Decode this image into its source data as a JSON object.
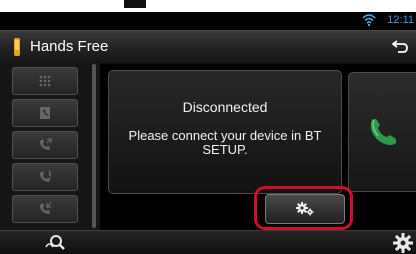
{
  "status_bar": {
    "time": "12:11",
    "icons": [
      "wifi-icon"
    ]
  },
  "title_bar": {
    "title": "Hands Free",
    "icon": "phone-app-icon",
    "back_icon": "back-icon"
  },
  "sidebar": {
    "buttons": [
      {
        "name": "dial-pad-button",
        "icon": "dial-pad-icon"
      },
      {
        "name": "phonebook-button",
        "icon": "phonebook-icon"
      },
      {
        "name": "outgoing-calls-button",
        "icon": "outgoing-call-icon"
      },
      {
        "name": "missed-calls-button",
        "icon": "missed-call-icon"
      },
      {
        "name": "incoming-calls-button",
        "icon": "incoming-call-icon"
      }
    ]
  },
  "message": {
    "status": "Disconnected",
    "instruction": "Please connect your device in BT SETUP."
  },
  "actions": {
    "call_icon": "phone-handset-icon",
    "setup_icon": "settings-gears-icon",
    "highlight_color": "#d10e2a"
  },
  "bottom_bar": {
    "left_icon": "voice-search-icon",
    "right_icon": "settings-gear-icon"
  },
  "colors": {
    "clock": "#3a9bd8",
    "call_icon": "#2e9b4a"
  }
}
